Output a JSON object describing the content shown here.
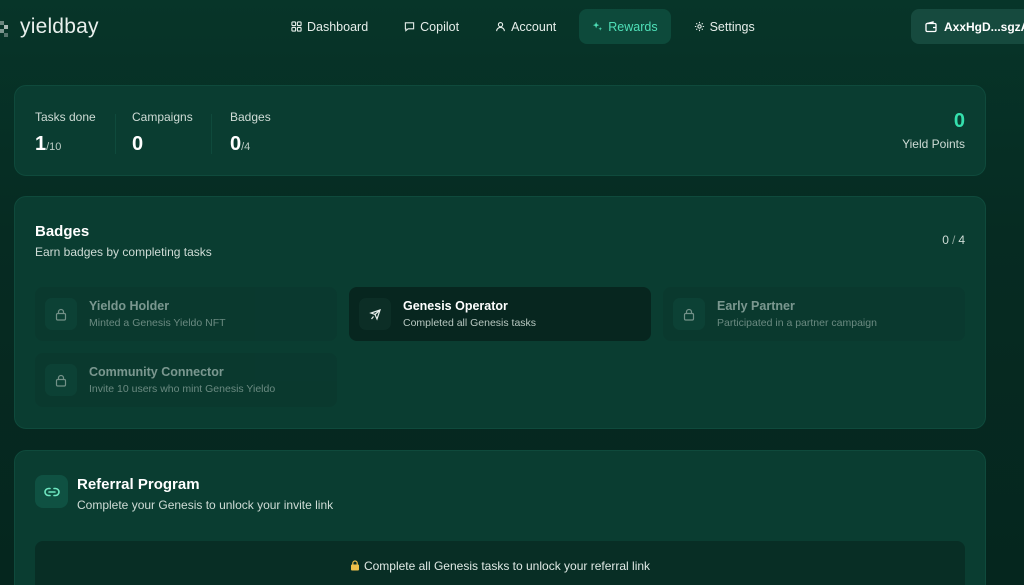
{
  "brand": {
    "name": "yieldbay"
  },
  "nav": {
    "items": [
      {
        "label": "Dashboard",
        "icon": "grid-icon",
        "active": false
      },
      {
        "label": "Copilot",
        "icon": "chat-icon",
        "active": false
      },
      {
        "label": "Account",
        "icon": "user-icon",
        "active": false
      },
      {
        "label": "Rewards",
        "icon": "sparkle-icon",
        "active": true
      },
      {
        "label": "Settings",
        "icon": "gear-icon",
        "active": false
      }
    ]
  },
  "wallet": {
    "label": "AxxHgD...sgzA",
    "icon": "wallet-icon"
  },
  "stats": {
    "tasks_label": "Tasks done",
    "tasks_value": "1",
    "tasks_total": "/10",
    "campaigns_label": "Campaigns",
    "campaigns_value": "0",
    "badges_label": "Badges",
    "badges_value": "0",
    "badges_total": "/4",
    "yield_value": "0",
    "yield_label": "Yield Points"
  },
  "badges": {
    "title": "Badges",
    "subtitle": "Earn badges by completing tasks",
    "earned": "0",
    "total": "4",
    "items": [
      {
        "name": "Yieldo Holder",
        "desc": "Minted a Genesis Yieldo NFT",
        "status": "locked",
        "icon": "lock-icon"
      },
      {
        "name": "Genesis Operator",
        "desc": "Completed all Genesis tasks",
        "status": "earned",
        "icon": "rocket-icon"
      },
      {
        "name": "Early Partner",
        "desc": "Participated in a partner campaign",
        "status": "locked",
        "icon": "lock-icon"
      },
      {
        "name": "Community Connector",
        "desc": "Invite 10 users who mint Genesis Yieldo",
        "status": "locked",
        "icon": "lock-icon"
      }
    ]
  },
  "referral": {
    "title": "Referral Program",
    "subtitle": "Complete your Genesis to unlock your invite link",
    "locked_message": "Complete all Genesis tasks to unlock your referral link",
    "icon": "link-icon"
  },
  "colors": {
    "accent": "#35e0ad",
    "background": "#062a21",
    "card": "#0a3d31",
    "active_nav": "#0d4a3b"
  }
}
